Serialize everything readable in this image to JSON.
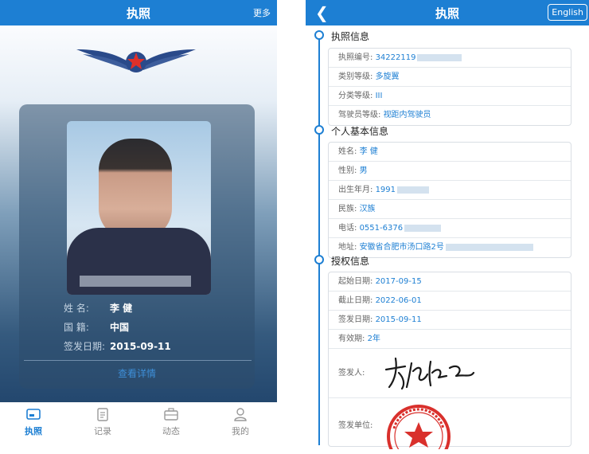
{
  "left": {
    "header": {
      "title": "执照",
      "more_label": "更多"
    },
    "card": {
      "name_label": "姓    名:",
      "name_value": "李  健",
      "nationality_label": "国    籍:",
      "nationality_value": "中国",
      "issue_date_label": "签发日期:",
      "issue_date_value": "2015-09-11",
      "detail_link": "查看详情"
    },
    "tabs": [
      {
        "label": "执照",
        "icon": "license-icon",
        "active": true
      },
      {
        "label": "记录",
        "icon": "clipboard-icon",
        "active": false
      },
      {
        "label": "动态",
        "icon": "briefcase-icon",
        "active": false
      },
      {
        "label": "我的",
        "icon": "person-icon",
        "active": false
      }
    ]
  },
  "right": {
    "header": {
      "title": "执照",
      "english_label": "English",
      "back_icon": "chevron-left-icon"
    },
    "sections": [
      {
        "title": "执照信息",
        "fields": [
          {
            "label": "执照编号:",
            "value": "34222119"
          },
          {
            "label": "类别等级:",
            "value": "多旋翼"
          },
          {
            "label": "分类等级:",
            "value": "III"
          },
          {
            "label": "驾驶员等级:",
            "value": "视距内驾驶员"
          }
        ]
      },
      {
        "title": "个人基本信息",
        "fields": [
          {
            "label": "姓名:",
            "value": "李  健"
          },
          {
            "label": "性别:",
            "value": "男"
          },
          {
            "label": "出生年月:",
            "value": "1991"
          },
          {
            "label": "民族:",
            "value": "汉族"
          },
          {
            "label": "电话:",
            "value": "0551-6376"
          },
          {
            "label": "地址:",
            "value": "安徽省合肥市汤口路2号"
          }
        ]
      },
      {
        "title": "授权信息",
        "fields": [
          {
            "label": "起始日期:",
            "value": "2017-09-15"
          },
          {
            "label": "截止日期:",
            "value": "2022-06-01"
          },
          {
            "label": "签发日期:",
            "value": "2015-09-11"
          },
          {
            "label": "有效期:",
            "value": "2年"
          }
        ],
        "issuer_label": "签发人:",
        "issuer_unit_label": "签发单位:"
      }
    ]
  },
  "colors": {
    "primary": "#1d7fd3",
    "stamp": "#d9302c"
  }
}
